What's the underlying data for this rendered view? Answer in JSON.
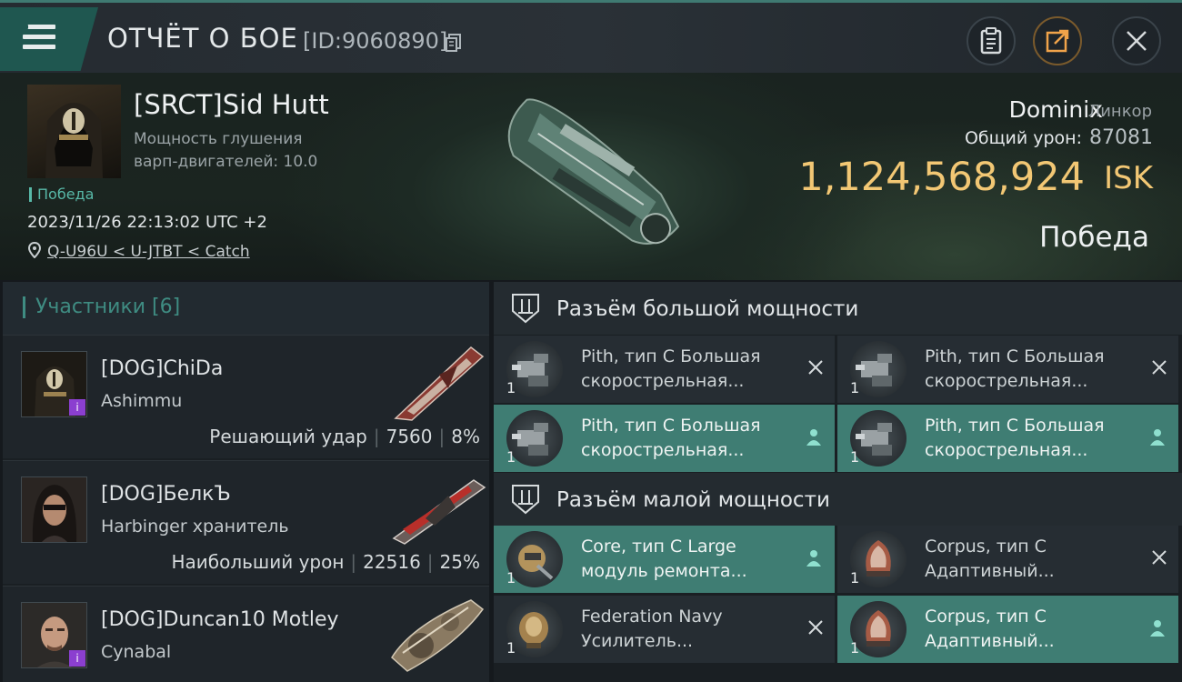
{
  "header": {
    "title": "ОТЧЁТ О БОЕ",
    "report_id": "[ID:9060890]"
  },
  "victim": {
    "name": "[SRCT]Sid Hutt",
    "warp_label": "Мощность глушения",
    "warp_value": "варп-двигателей: 10.0",
    "result_tag": "Победа",
    "datetime": "2023/11/26 22:13:02 UTC +2",
    "location": "Q-U96U < U-JTBT < Catch",
    "ship": "Dominix",
    "ship_class": "Линкор",
    "damage_label": "Общий урон:",
    "damage_value": "87081",
    "isk_value": "1,124,568,924",
    "isk_unit": "ISK",
    "result": "Победа"
  },
  "participants": {
    "title": "Участники [6]",
    "items": [
      {
        "name": "[DOG]ChiDa",
        "ship": "Ashimmu",
        "stat_label": "Решающий удар",
        "damage": "7560",
        "percent": "8%",
        "badge": "i"
      },
      {
        "name": "[DOG]БелкЪ",
        "ship": "Harbinger хранитель",
        "stat_label": "Наибольший урон",
        "damage": "22516",
        "percent": "25%",
        "badge": ""
      },
      {
        "name": "[DOG]Duncan10 Motley",
        "ship": "Cynabal",
        "stat_label": "",
        "damage": "",
        "percent": "",
        "badge": "i"
      }
    ]
  },
  "modules": {
    "high_title": "Разъём большой мощности",
    "low_title": "Разъём малой мощности",
    "high": [
      {
        "line1": "Pith, тип C Большая",
        "line2": "скорострельная...",
        "qty": "1",
        "state": "destroyed"
      },
      {
        "line1": "Pith, тип C Большая",
        "line2": "скорострельная...",
        "qty": "1",
        "state": "destroyed"
      },
      {
        "line1": "Pith, тип C Большая",
        "line2": "скорострельная...",
        "qty": "1",
        "state": "dropped"
      },
      {
        "line1": "Pith, тип C Большая",
        "line2": "скорострельная...",
        "qty": "1",
        "state": "dropped"
      }
    ],
    "low": [
      {
        "line1": "Core, тип C Large",
        "line2": "модуль ремонта...",
        "qty": "1",
        "state": "dropped"
      },
      {
        "line1": "Corpus, тип C",
        "line2": "Адаптивный...",
        "qty": "1",
        "state": "destroyed"
      },
      {
        "line1": "Federation Navy",
        "line2": "Усилитель...",
        "qty": "1",
        "state": "destroyed"
      },
      {
        "line1": "Corpus, тип C",
        "line2": "Адаптивный...",
        "qty": "1",
        "state": "dropped"
      }
    ]
  },
  "colors": {
    "accent": "#3f7d73",
    "isk": "#f2c774",
    "badge": "#8b3fd0"
  },
  "icons": [
    "menu-icon",
    "copy-icon",
    "clipboard-icon",
    "share-icon",
    "close-icon",
    "location-pin-icon",
    "slot-icon",
    "destroyed-x-icon",
    "dropped-person-icon"
  ]
}
